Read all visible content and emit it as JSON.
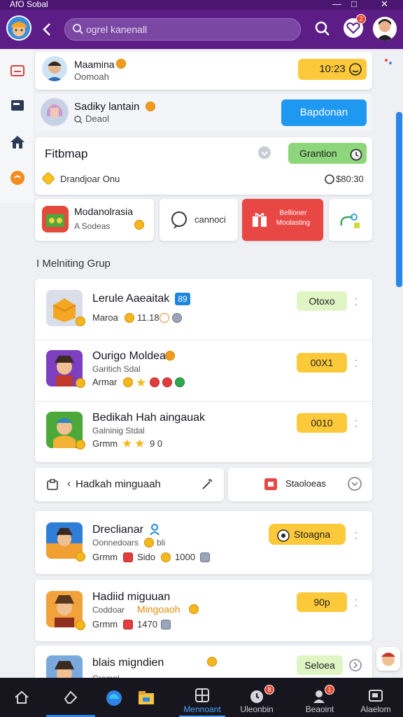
{
  "window": {
    "title": "AfO Sobal",
    "min": "—",
    "max": "□",
    "close": "✕"
  },
  "header": {
    "search_placeholder": "ogrel kanenall",
    "heart_badge": "2"
  },
  "accounts": [
    {
      "name": "Maamina",
      "sub": "Oomoah",
      "time": "10:23"
    },
    {
      "name": "Sadiky lantain",
      "sub": "Deaol",
      "action": "Bapdonan"
    }
  ],
  "featured": {
    "title": "Fitbmap",
    "button": "Grantion",
    "line": "Drandjoar Onu",
    "amount": "$80:30"
  },
  "quick": [
    {
      "title": "Modanolrasia",
      "sub": "A Sodeas"
    },
    {
      "title": "cannoci"
    },
    {
      "title": "Bellioner Moolasting"
    }
  ],
  "section_title": "I Melniting Grup",
  "games": [
    {
      "name": "Lerule Aaeaitak",
      "tag": "89",
      "sub": "Maroa",
      "meta": "11.18",
      "pill": "Otoxo",
      "pill_color": "#dff5c4"
    },
    {
      "name": "Ourigo Moldea",
      "sub": "Garitich Sdal",
      "sub2": "Armar",
      "pill": "00X1",
      "pill_color": "#fcc93a"
    },
    {
      "name": "Bedikah Hah aingauak",
      "sub": "Galninig Stdal",
      "sub2": "Grmm",
      "meta": "9 0",
      "pill": "0010",
      "pill_color": "#fcc93a"
    }
  ],
  "split": {
    "left": "Hadkah minguaah",
    "right": "Staoloeas"
  },
  "games2": [
    {
      "name": "Dreclianar",
      "sub": "Oonnedoars",
      "sub_extra": "bli",
      "sub2": "Grmm",
      "meta": "Sido",
      "meta2": "1000",
      "pill": "Stoagna",
      "pill_color": "#fcc93a"
    },
    {
      "name": "Hadiid miguuan",
      "sub": "Coddoar",
      "sub_accent": "Mingoaoh",
      "sub2": "Grmm",
      "meta": "1470",
      "pill": "90p",
      "pill_color": "#fcc93a"
    },
    {
      "name": "blais migndien",
      "sub": "Cramnl",
      "pill": "Seloea",
      "pill_color": "#dff5c4"
    }
  ],
  "tabs": [
    {
      "label": ""
    },
    {
      "label": ""
    },
    {
      "label": ""
    },
    {
      "label": ""
    },
    {
      "label": "Mennoant"
    },
    {
      "label": "Uleonbin",
      "badge": "8"
    },
    {
      "label": "Beaoint",
      "badge": "1"
    },
    {
      "label": "Alaelom"
    }
  ],
  "colors": {
    "brand": "#5c1d86",
    "accent": "#2a87e6",
    "yellow": "#fcc93a",
    "green": "#8ed67b",
    "red": "#e94744"
  }
}
